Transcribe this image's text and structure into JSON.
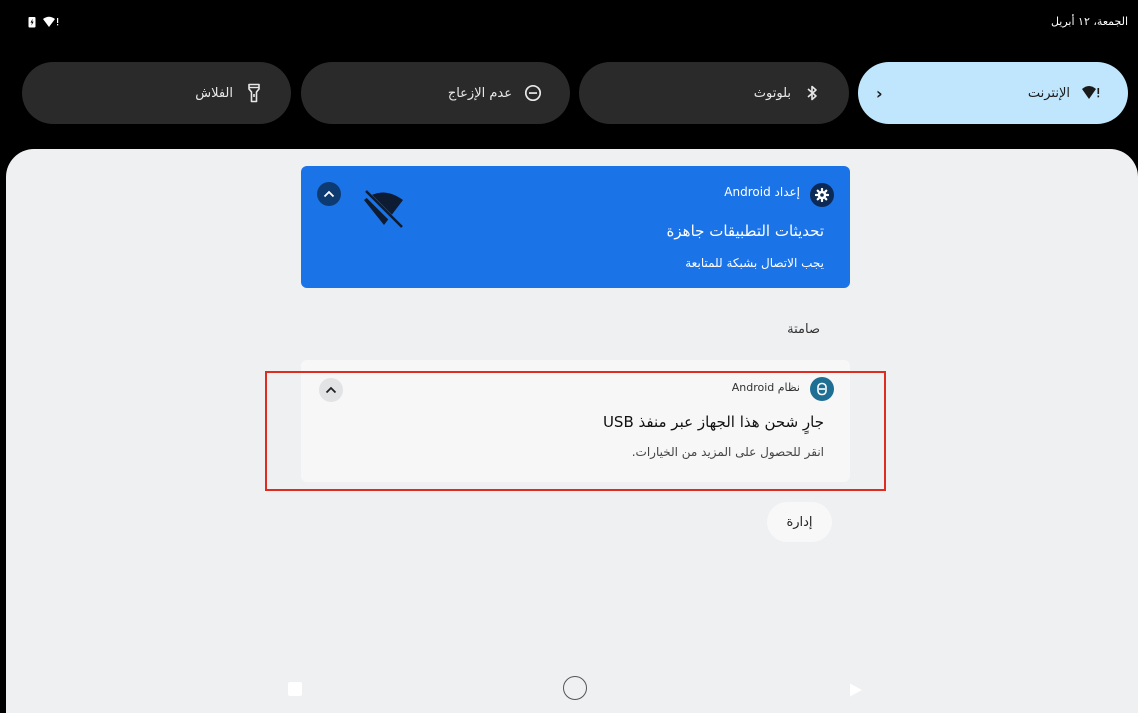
{
  "status_bar": {
    "date": "الجمعة، ١٢ أبريل",
    "icons": [
      "battery-icon",
      "wifi-icon"
    ]
  },
  "quick_tiles": [
    {
      "label": "الإنترنت",
      "icon": "wifi-icon",
      "active": true,
      "has_chevron": true
    },
    {
      "label": "بلوتوث",
      "icon": "bluetooth-icon",
      "active": false
    },
    {
      "label": "عدم الإزعاج",
      "icon": "do-not-disturb-icon",
      "active": false
    },
    {
      "label": "الفلاش",
      "icon": "flashlight-icon",
      "active": false
    }
  ],
  "notifications": {
    "setup": {
      "app_name": "إعداد Android",
      "title": "تحديثات التطبيقات جاهزة",
      "text": "يجب الاتصال بشبكة للمتابعة",
      "color": "#1b73e8"
    },
    "silent_label": "صامتة",
    "usb": {
      "app_name": "نظام Android",
      "title": "جارٍ شحن هذا الجهاز عبر منفذ USB",
      "text": "انقر للحصول على المزيد من الخيارات."
    },
    "manage_label": "إدارة"
  },
  "highlight_color": "#e02b20"
}
